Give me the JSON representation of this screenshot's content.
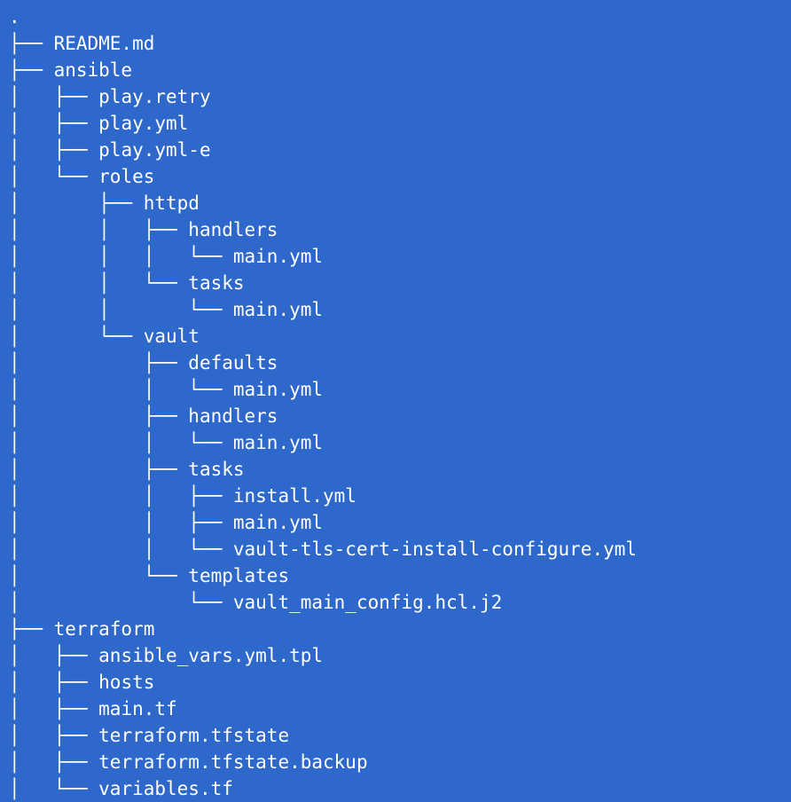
{
  "terminal": {
    "background_color": "#2d68ca",
    "foreground_color": "#ffffff",
    "root_label": ".",
    "tree_lines": [
      {
        "prefix": "",
        "name": "."
      },
      {
        "prefix": "├── ",
        "name": "README.md"
      },
      {
        "prefix": "├── ",
        "name": "ansible"
      },
      {
        "prefix": "│   ├── ",
        "name": "play.retry"
      },
      {
        "prefix": "│   ├── ",
        "name": "play.yml"
      },
      {
        "prefix": "│   ├── ",
        "name": "play.yml-e"
      },
      {
        "prefix": "│   └── ",
        "name": "roles"
      },
      {
        "prefix": "│       ├── ",
        "name": "httpd"
      },
      {
        "prefix": "│       │   ├── ",
        "name": "handlers"
      },
      {
        "prefix": "│       │   │   └── ",
        "name": "main.yml"
      },
      {
        "prefix": "│       │   └── ",
        "name": "tasks"
      },
      {
        "prefix": "│       │       └── ",
        "name": "main.yml"
      },
      {
        "prefix": "│       └── ",
        "name": "vault"
      },
      {
        "prefix": "│           ├── ",
        "name": "defaults"
      },
      {
        "prefix": "│           │   └── ",
        "name": "main.yml"
      },
      {
        "prefix": "│           ├── ",
        "name": "handlers"
      },
      {
        "prefix": "│           │   └── ",
        "name": "main.yml"
      },
      {
        "prefix": "│           ├── ",
        "name": "tasks"
      },
      {
        "prefix": "│           │   ├── ",
        "name": "install.yml"
      },
      {
        "prefix": "│           │   ├── ",
        "name": "main.yml"
      },
      {
        "prefix": "│           │   └── ",
        "name": "vault-tls-cert-install-configure.yml"
      },
      {
        "prefix": "│           └── ",
        "name": "templates"
      },
      {
        "prefix": "│               └── ",
        "name": "vault_main_config.hcl.j2"
      },
      {
        "prefix": "├── ",
        "name": "terraform"
      },
      {
        "prefix": "│   ├── ",
        "name": "ansible_vars.yml.tpl"
      },
      {
        "prefix": "│   ├── ",
        "name": "hosts"
      },
      {
        "prefix": "│   ├── ",
        "name": "main.tf"
      },
      {
        "prefix": "│   ├── ",
        "name": "terraform.tfstate"
      },
      {
        "prefix": "│   ├── ",
        "name": "terraform.tfstate.backup"
      },
      {
        "prefix": "│   └── ",
        "name": "variables.tf"
      }
    ]
  }
}
